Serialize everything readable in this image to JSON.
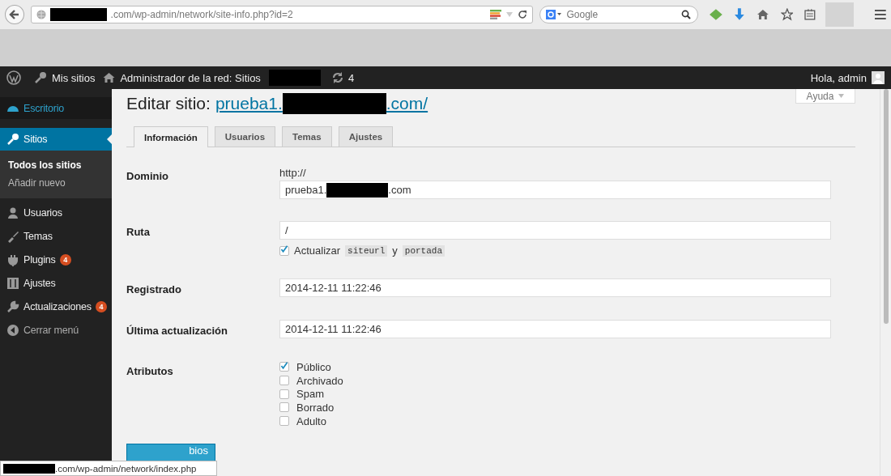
{
  "browser": {
    "url": ".com/wp-admin/network/site-info.php?id=2",
    "search": {
      "placeholder": "Google"
    }
  },
  "admin_bar": {
    "my_sites": "Mis sitios",
    "network_admin": "Administrador de la red: Sitios",
    "updates": "4",
    "greeting": "Hola, admin"
  },
  "help_tab": {
    "label": "Ayuda"
  },
  "sidebar": {
    "items": [
      {
        "kind": "dashboard",
        "label": "Escritorio",
        "selected": false,
        "highlighted": true
      },
      {
        "kind": "sites",
        "label": "Sitios",
        "selected": true,
        "highlighted": false,
        "children": [
          {
            "label": "Todos los sitios",
            "selected": true
          },
          {
            "label": "Añadir nuevo",
            "selected": false
          }
        ]
      },
      {
        "kind": "users",
        "label": "Usuarios",
        "selected": false,
        "highlighted": false
      },
      {
        "kind": "themes",
        "label": "Temas",
        "selected": false,
        "highlighted": false
      },
      {
        "kind": "plugins",
        "label": "Plugins",
        "selected": false,
        "highlighted": false,
        "badge": "4"
      },
      {
        "kind": "settings",
        "label": "Ajustes",
        "selected": false,
        "highlighted": false
      },
      {
        "kind": "updates",
        "label": "Actualizaciones",
        "selected": false,
        "highlighted": false,
        "badge": "4"
      },
      {
        "kind": "collapse",
        "label": "Cerrar menú",
        "selected": false,
        "highlighted": false
      }
    ]
  },
  "page": {
    "title": "Editar sitio:",
    "link_start": "prueba1.",
    "link_end": ".com/",
    "tabs": [
      {
        "label": "Información",
        "selected": true
      },
      {
        "label": "Usuarios",
        "selected": false
      },
      {
        "label": "Temas",
        "selected": false
      },
      {
        "label": "Ajustes",
        "selected": false
      }
    ],
    "rows": [
      {
        "kind": "domain",
        "label": "Dominio",
        "prefix": "http://",
        "value_start": "prueba1.",
        "value_end": ".com"
      },
      {
        "kind": "path",
        "label": "Ruta",
        "value": "/",
        "option": {
          "checked": true,
          "text_before": "Actualizar",
          "code_1": "siteurl",
          "text_middle": "y",
          "code_2": "portada"
        }
      },
      {
        "kind": "text",
        "label": "Registrado",
        "value": "2014-12-11 11:22:46"
      },
      {
        "kind": "text",
        "label": "Última actualización",
        "value": "2014-12-11 11:22:46"
      },
      {
        "kind": "checks",
        "label": "Atributos",
        "options": [
          {
            "label": "Público",
            "checked": true
          },
          {
            "label": "Archivado",
            "checked": false
          },
          {
            "label": "Spam",
            "checked": false
          },
          {
            "label": "Borrado",
            "checked": false
          },
          {
            "label": "Adulto",
            "checked": false
          }
        ]
      }
    ],
    "save_button": {
      "visible_label": "bios"
    }
  },
  "status_bar": {
    "url": ".com/wp-admin/network/index.php"
  }
}
